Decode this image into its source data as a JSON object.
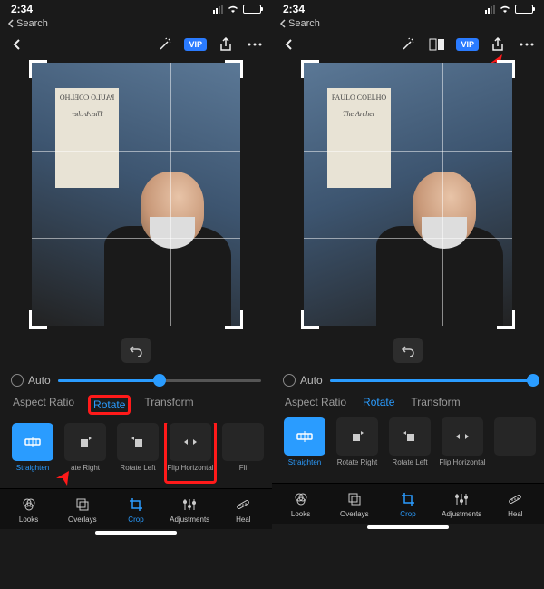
{
  "status": {
    "time": "2:34",
    "back_label": "Search"
  },
  "toolbar": {
    "vip": "VIP"
  },
  "book": {
    "author": "PAULO COELHO",
    "title": "The Archer"
  },
  "slider": {
    "auto_label": "Auto",
    "value_pct": 50
  },
  "tabs": {
    "aspect": "Aspect Ratio",
    "rotate": "Rotate",
    "transform": "Transform"
  },
  "actions": {
    "straighten": "Straighten",
    "rotate_right": "Rotate Right",
    "rotate_right_cut_left": "ate Right",
    "rotate_left": "Rotate Left",
    "flip_h": "Flip Horizontal",
    "flip_cut": "Fli"
  },
  "nav": {
    "looks": "Looks",
    "overlays": "Overlays",
    "crop": "Crop",
    "adjustments": "Adjustments",
    "heal": "Heal"
  }
}
